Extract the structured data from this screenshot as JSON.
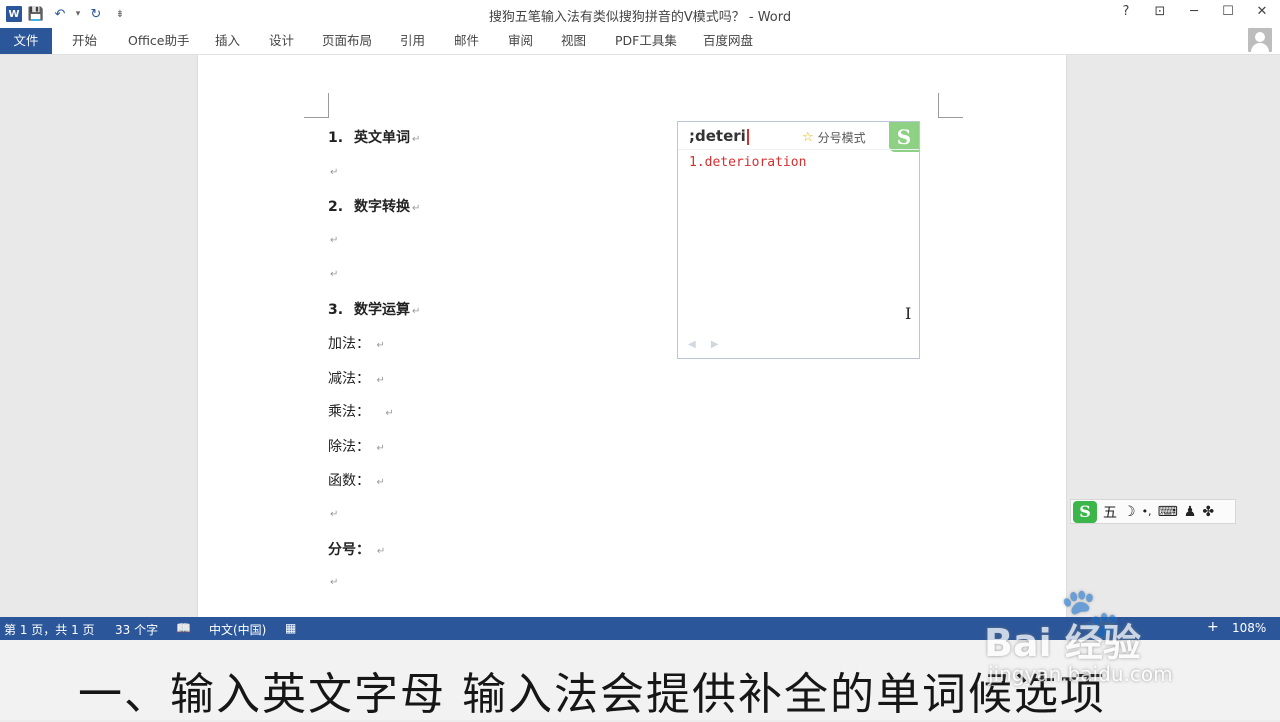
{
  "window": {
    "title": "搜狗五笔输入法有类似搜狗拼音的V模式吗？ - Word",
    "help": "?",
    "restore_ribbon": "⊡",
    "minimize": "─",
    "maximize": "☐",
    "close": "✕"
  },
  "qat": {
    "word_icon": "W",
    "save_icon": "💾",
    "undo_icon": "↶",
    "dropdown_icon": "▾",
    "redo_icon": "↻",
    "customize_icon": "⇟"
  },
  "ribbon": {
    "tabs": [
      "文件",
      "开始",
      "Office助手",
      "插入",
      "设计",
      "页面布局",
      "引用",
      "邮件",
      "审阅",
      "视图",
      "PDF工具集",
      "百度网盘"
    ]
  },
  "doc": {
    "item1_num": "1.",
    "item1": "英文单词",
    "item2_num": "2.",
    "item2": "数字转换",
    "item3_num": "3.",
    "item3": "数学运算",
    "add": "加法：",
    "sub": "减法：",
    "mul": "乘法：",
    "div": "除法：",
    "func": "函数：",
    "fraction": "分号：",
    "para_mark": "↵"
  },
  "ime": {
    "input": ";deteri",
    "mode_label": "分号模式",
    "logo": "S",
    "candidate": "1.deterioration",
    "page_arrows": "◀ ▶"
  },
  "imebar": {
    "logo": "S",
    "mode": "五",
    "moon_icon": "☽",
    "punct_icon": "•,",
    "keyboard_icon": "⌨",
    "user_icon": "♟",
    "tools_icon": "✤"
  },
  "status": {
    "page": "第 1 页，共 1 页",
    "words": "33 个字",
    "proof_icon": "📖",
    "language": "中文(中国)",
    "macro_icon": "▦",
    "zoom_in": "+",
    "zoom": "108%"
  },
  "caption": {
    "text": "一、输入英文字母  输入法会提供补全的单词候选项"
  },
  "watermark": {
    "brand": "Bai 经验",
    "url": "jingyan.baidu.com"
  }
}
